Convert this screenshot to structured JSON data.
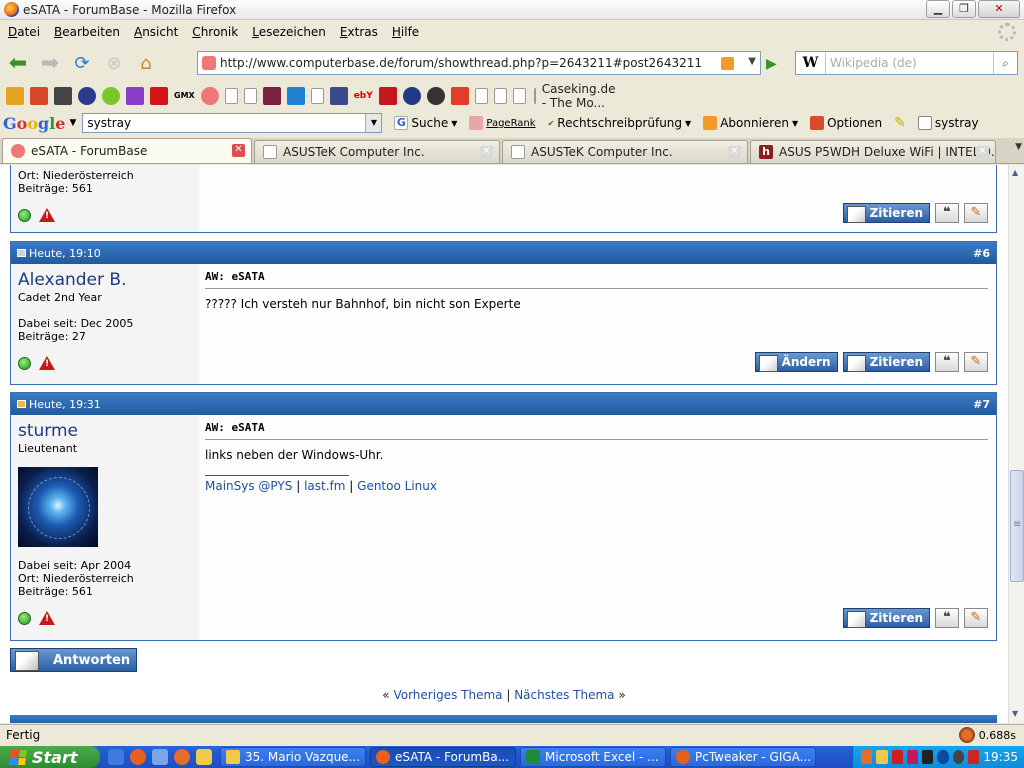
{
  "window": {
    "title": "eSATA - ForumBase - Mozilla Firefox"
  },
  "menu": [
    "Datei",
    "Bearbeiten",
    "Ansicht",
    "Chronik",
    "Lesezeichen",
    "Extras",
    "Hilfe"
  ],
  "nav": {
    "url": "http://www.computerbase.de/forum/showthread.php?p=2643211#post2643211",
    "search_placeholder": "Wikipedia (de)"
  },
  "bookmarks": {
    "caseking": "Caseking.de - The Mo...",
    "text_icons": [
      "GMX",
      "ebY"
    ]
  },
  "google_bar": {
    "query": "systray",
    "suche": "Suche",
    "pagerank": "PageRank",
    "spell": "Rechtschreibprüfung",
    "subscribe": "Abonnieren",
    "options": "Optionen",
    "highlight": "systray"
  },
  "tabs": [
    {
      "label": "eSATA - ForumBase",
      "active": true
    },
    {
      "label": "ASUSTeK Computer Inc.",
      "active": false
    },
    {
      "label": "ASUSTeK Computer Inc.",
      "active": false
    },
    {
      "label": "ASUS P5WDH Deluxe WiFi | INTEL 9...",
      "active": false
    }
  ],
  "posts": [
    {
      "partial_top": true,
      "info": [
        "Ort: Niederösterreich",
        "Beiträge: 561"
      ],
      "buttons": {
        "quote": "Zitieren"
      }
    },
    {
      "date": "Heute, 19:10",
      "number": "#6",
      "user": "Alexander B.",
      "rank": "Cadet 2nd Year",
      "info": [
        "Dabei seit: Dec 2005",
        "Beiträge: 27"
      ],
      "title": "AW: eSATA",
      "text": "????? Ich versteh nur Bahnhof, bin nicht son Experte",
      "buttons": {
        "edit": "Ändern",
        "quote": "Zitieren"
      }
    },
    {
      "date": "Heute, 19:31",
      "number": "#7",
      "user": "sturme",
      "rank": "Lieutenant",
      "info": [
        "Dabei seit: Apr 2004",
        "Ort: Niederösterreich",
        "Beiträge: 561"
      ],
      "title": "AW: eSATA",
      "text": "links neben der Windows-Uhr.",
      "signature": [
        "MainSys @PYS",
        "last.fm",
        "Gentoo Linux"
      ],
      "sig_sep": "|",
      "buttons": {
        "quote": "Zitieren"
      }
    }
  ],
  "reply_button": "Antworten",
  "thread_nav": {
    "prev_marker": "«",
    "prev": "Vorheriges Thema",
    "sep": "|",
    "next": "Nächstes Thema",
    "next_marker": "»"
  },
  "status": {
    "text": "Fertig",
    "time": "0.688s"
  },
  "taskbar": {
    "start": "Start",
    "tasks": [
      {
        "label": "35. Mario Vazque...",
        "active": false
      },
      {
        "label": "eSATA - ForumBa...",
        "active": true
      },
      {
        "label": "Microsoft Excel - ...",
        "active": false
      },
      {
        "label": "PcTweaker - GIGA...",
        "active": false
      }
    ],
    "clock": "19:35"
  }
}
